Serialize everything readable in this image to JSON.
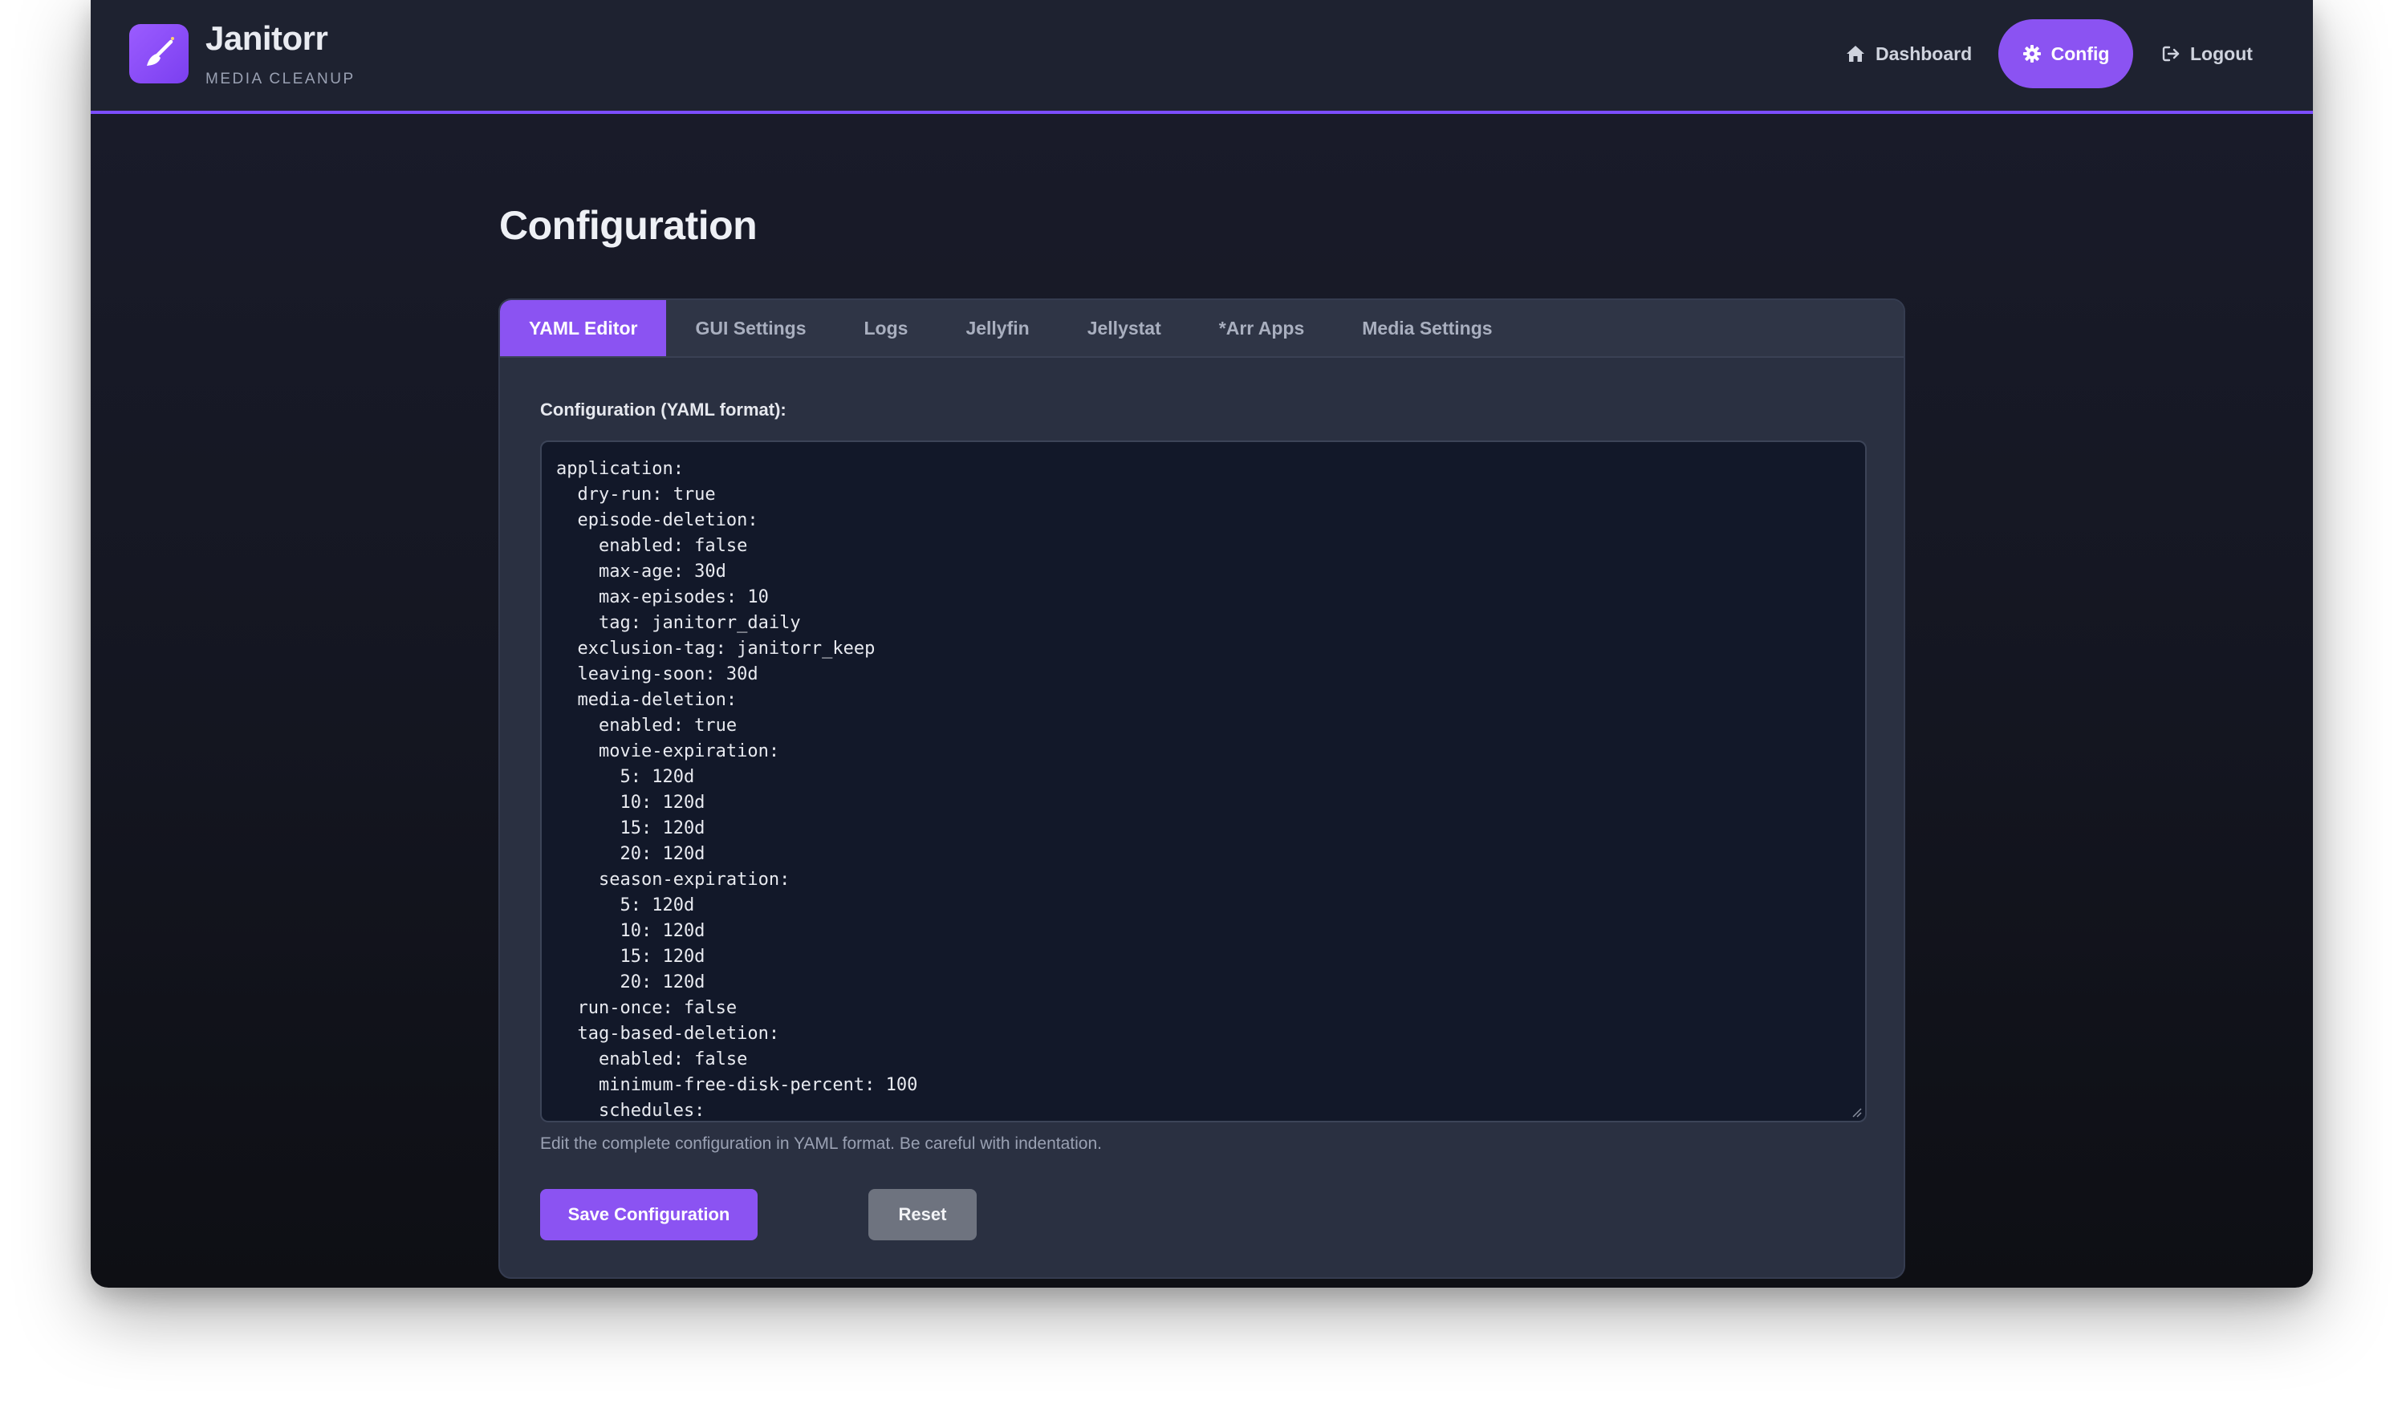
{
  "app": {
    "title": "Janitorr",
    "subtitle": "MEDIA CLEANUP",
    "logo_icon": "broom-icon",
    "accent_color": "#8b53f2"
  },
  "nav": {
    "dashboard": {
      "label": "Dashboard",
      "icon": "home-icon"
    },
    "config": {
      "label": "Config",
      "icon": "gear-icon",
      "active": true
    },
    "logout": {
      "label": "Logout",
      "icon": "logout-icon"
    }
  },
  "page": {
    "title": "Configuration"
  },
  "tabs": [
    {
      "label": "YAML Editor",
      "active": true
    },
    {
      "label": "GUI Settings"
    },
    {
      "label": "Logs"
    },
    {
      "label": "Jellyfin"
    },
    {
      "label": "Jellystat"
    },
    {
      "label": "*Arr Apps"
    },
    {
      "label": "Media Settings"
    }
  ],
  "editor": {
    "label": "Configuration (YAML format):",
    "content": "application:\n  dry-run: true\n  episode-deletion:\n    enabled: false\n    max-age: 30d\n    max-episodes: 10\n    tag: janitorr_daily\n  exclusion-tag: janitorr_keep\n  leaving-soon: 30d\n  media-deletion:\n    enabled: true\n    movie-expiration:\n      5: 120d\n      10: 120d\n      15: 120d\n      20: 120d\n    season-expiration:\n      5: 120d\n      10: 120d\n      15: 120d\n      20: 120d\n  run-once: false\n  tag-based-deletion:\n    enabled: false\n    minimum-free-disk-percent: 100\n    schedules:",
    "hint": "Edit the complete configuration in YAML format. Be careful with indentation."
  },
  "buttons": {
    "save": "Save Configuration",
    "reset": "Reset"
  }
}
